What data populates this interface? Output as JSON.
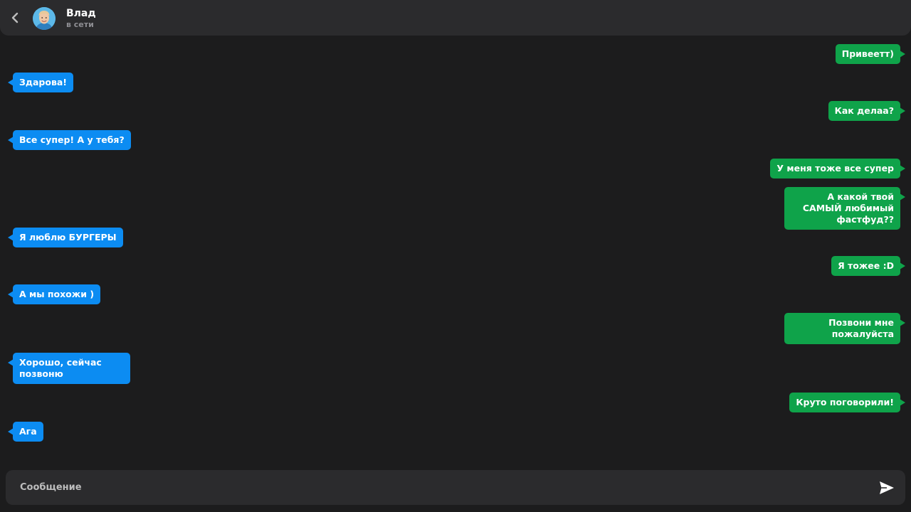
{
  "header": {
    "contact_name": "Влад",
    "contact_status": "в сети",
    "back_icon": "chevron-left-icon",
    "avatar_icon": "user-avatar"
  },
  "messages": [
    {
      "direction": "out",
      "text": "Привеетт)"
    },
    {
      "direction": "in",
      "text": "Здарова!"
    },
    {
      "direction": "out",
      "text": "Как делаа?"
    },
    {
      "direction": "in",
      "text": "Все супер! А у тебя?"
    },
    {
      "direction": "out",
      "text": "У меня тоже все супер"
    },
    {
      "direction": "out",
      "text": "А какой твой САМЫЙ любимый фастфуд??"
    },
    {
      "direction": "in",
      "text": "Я люблю БУРГЕРЫ"
    },
    {
      "direction": "out",
      "text": "Я тожее :D"
    },
    {
      "direction": "in",
      "text": "А мы похожи )"
    },
    {
      "direction": "out",
      "text": "Позвони мне пожалуйста"
    },
    {
      "direction": "in",
      "text": "Хорошо, сейчас позвоню"
    },
    {
      "direction": "out",
      "text": "Круто поговорили!"
    },
    {
      "direction": "in",
      "text": "Ага"
    }
  ],
  "composer": {
    "placeholder": "Сообщение",
    "value": "",
    "send_icon": "send-icon"
  },
  "colors": {
    "background": "#1c1c1d",
    "panel": "#2b2b2d",
    "incoming_bubble": "#0c8cf2",
    "outgoing_bubble": "#0fa34a",
    "status_text": "#8e8e93"
  }
}
